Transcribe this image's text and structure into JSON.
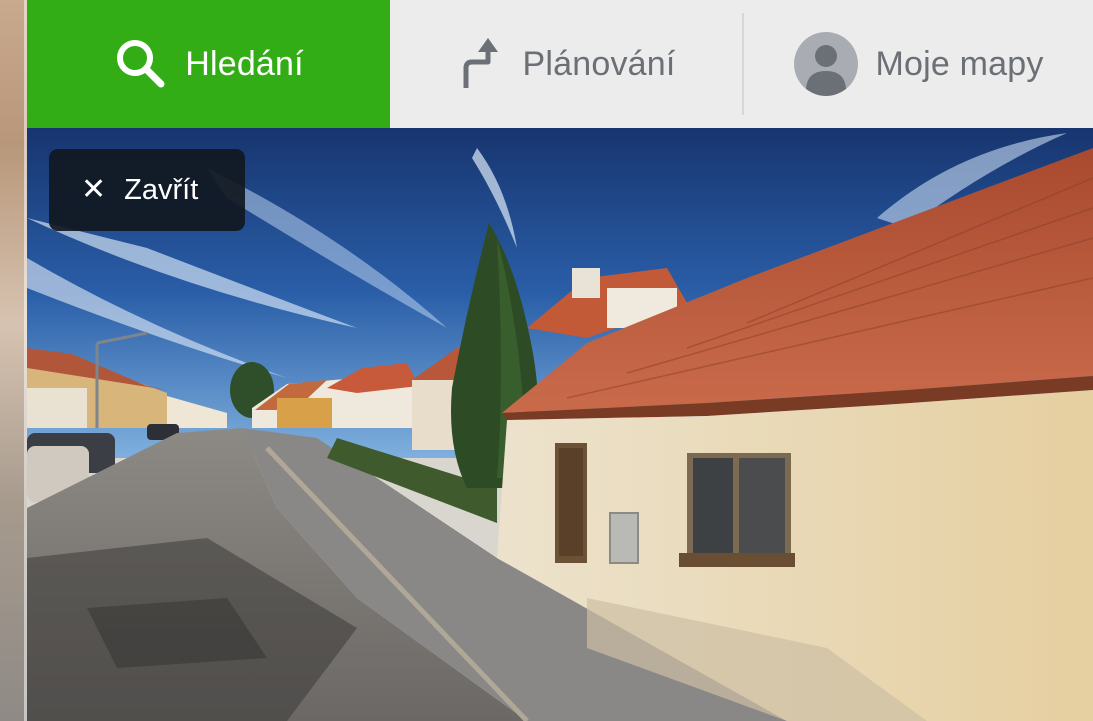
{
  "tabs": {
    "search": {
      "label": "Hledání",
      "icon": "search-icon",
      "active": true
    },
    "planning": {
      "label": "Plánování",
      "icon": "route-turn-icon"
    },
    "my_maps": {
      "label": "Moje mapy",
      "icon": "user-avatar-icon"
    }
  },
  "panorama": {
    "close_label": "Zavřít",
    "close_icon": "close-icon"
  },
  "colors": {
    "active_tab": "#33ad16",
    "tab_bar": "#ececec",
    "tab_text": "#6b6f76",
    "close_button_bg": "#111821"
  }
}
